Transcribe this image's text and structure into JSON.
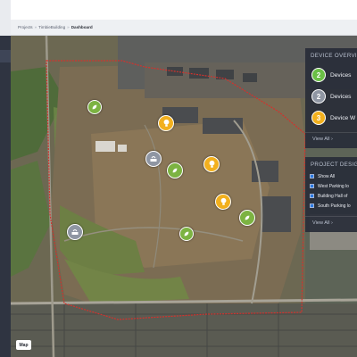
{
  "breadcrumb": {
    "items": [
      "Projects",
      "TimbieBuilding",
      "Dashboard"
    ],
    "separator": "»"
  },
  "map": {
    "logo_text": "Map",
    "site_boundary_color": "#d2322d"
  },
  "pins": [
    {
      "icon": "leaf-icon",
      "color": "#7cb342"
    },
    {
      "icon": "lightbulb-icon",
      "color": "#f2b01e"
    },
    {
      "icon": "lightbulb-icon",
      "color": "#f2b01e"
    },
    {
      "icon": "lightbulb-icon",
      "color": "#f2b01e"
    },
    {
      "icon": "signal-icon",
      "color": "#8f96a3"
    },
    {
      "icon": "leaf-icon",
      "color": "#7cb342"
    },
    {
      "icon": "leaf-icon",
      "color": "#7cb342"
    },
    {
      "icon": "signal-icon",
      "color": "#8f96a3"
    },
    {
      "icon": "leaf-icon",
      "color": "#7cb342"
    }
  ],
  "device_overview": {
    "title": "DEVICE OVERVIE",
    "rows": [
      {
        "count": "2",
        "label": "Devices",
        "color": "#6abf45"
      },
      {
        "count": "2",
        "label": "Devices",
        "color": "#8f96a3"
      },
      {
        "count": "3",
        "label": "Device W",
        "color": "#f2b01e"
      }
    ],
    "view_all": "View All ›"
  },
  "project_design": {
    "title": "PROJECT DESIGN",
    "options": [
      {
        "label": "Show All",
        "checked": true
      },
      {
        "label": "West Parking lo",
        "checked": true
      },
      {
        "label": "Building Hall of",
        "checked": true
      },
      {
        "label": "South Parking lo",
        "checked": true
      }
    ],
    "view_all": "View All ›"
  }
}
